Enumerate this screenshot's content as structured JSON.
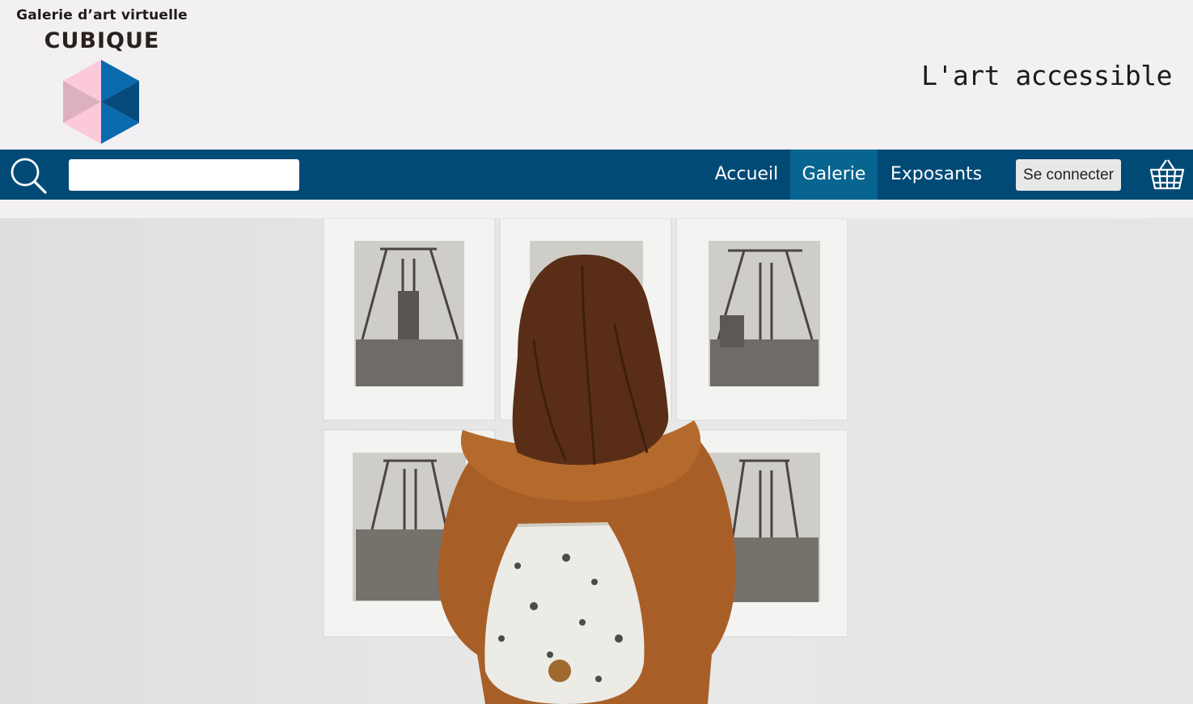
{
  "brand": {
    "subtitle": "Galerie d’art virtuelle",
    "name": "CUBIQUE",
    "logo_icon": "cube-logo-icon",
    "colors": {
      "pink": "#fcc9da",
      "pink_dark": "#ddb0bd",
      "blue": "#0a6aae",
      "blue_dark": "#074b7e"
    }
  },
  "tagline": "L'art accessible",
  "nav": {
    "search_icon": "search-icon",
    "search_placeholder": "",
    "items": [
      {
        "label": "Accueil",
        "active": false
      },
      {
        "label": "Galerie",
        "active": true
      },
      {
        "label": "Exposants",
        "active": false
      }
    ],
    "login_label": "Se connecter",
    "cart_icon": "shopping-basket-icon",
    "colors": {
      "bar": "#024a76",
      "active": "#086490"
    }
  },
  "hero": {
    "image": "hero-photo-woman-viewing-framed-photographs",
    "alt": ""
  }
}
